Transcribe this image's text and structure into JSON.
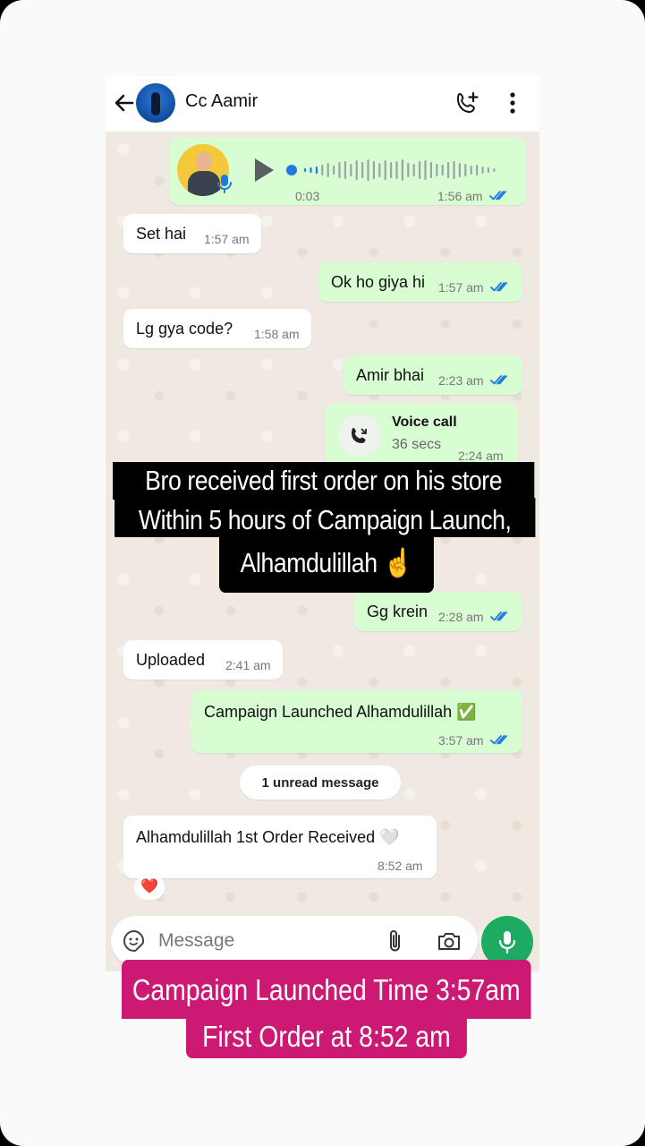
{
  "header": {
    "contact_name": "Cc Aamir",
    "icons": [
      "back-arrow-icon",
      "add-call-icon",
      "more-vertical-icon"
    ]
  },
  "messages": [
    {
      "type": "voice",
      "direction": "out",
      "duration": "0:03",
      "time": "1:56 am"
    },
    {
      "type": "text",
      "direction": "in",
      "text": "Set hai",
      "time": "1:57 am"
    },
    {
      "type": "text",
      "direction": "out",
      "text": "Ok ho giya hi",
      "time": "1:57 am"
    },
    {
      "type": "text",
      "direction": "in",
      "text": "Lg gya code?",
      "time": "1:58 am"
    },
    {
      "type": "text",
      "direction": "out",
      "text": "Amir bhai",
      "time": "2:23 am"
    },
    {
      "type": "call",
      "direction": "out",
      "title": "Voice call",
      "subtitle": "36 secs",
      "time": "2:24 am"
    },
    {
      "type": "text",
      "direction": "out",
      "text": "Gg krein",
      "time": "2:28 am"
    },
    {
      "type": "text",
      "direction": "in",
      "text": "Uploaded",
      "time": "2:41 am"
    },
    {
      "type": "text",
      "direction": "out",
      "text": "Campaign Launched Alhamdulillah ✅",
      "time": "3:57 am"
    },
    {
      "type": "text",
      "direction": "in",
      "text": "Alhamdulillah 1st Order Received 🤍",
      "time": "8:52 am",
      "reaction": "❤️"
    }
  ],
  "unread_banner": "1 unread message",
  "composer": {
    "placeholder": "Message"
  },
  "overlays": {
    "top_lines": [
      "Bro received first order on his store",
      "Within 5 hours of Campaign Launch,",
      "Alhamdulillah ☝️"
    ],
    "bottom_lines": [
      "Campaign Launched Time 3:57am",
      "First Order at 8:52 am"
    ]
  },
  "colors": {
    "outgoing_bubble": "#d8fdd2",
    "incoming_bubble": "#ffffff",
    "chat_background": "#efe9e2",
    "tick_blue": "#1f7ae0",
    "mic_green": "#1daa61",
    "overlay_pink": "#cc1a74"
  }
}
